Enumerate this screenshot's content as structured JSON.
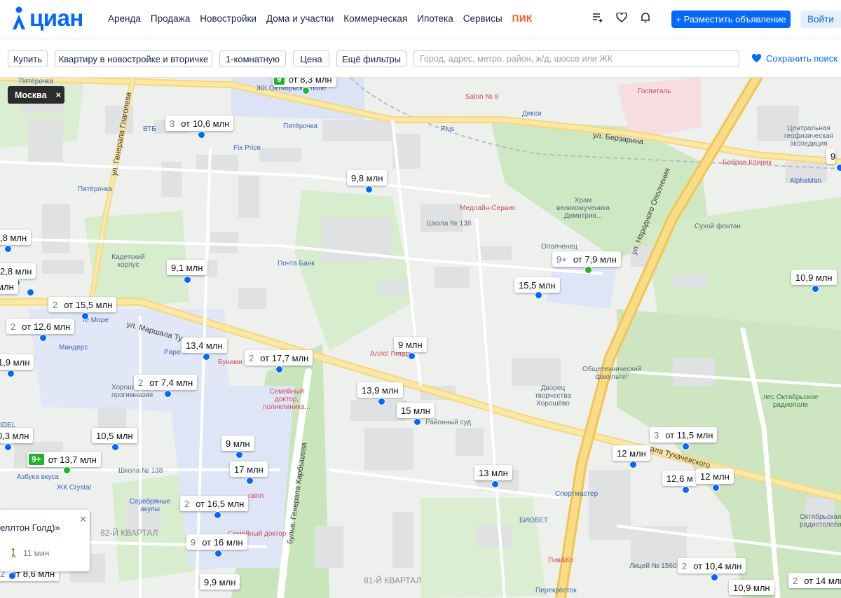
{
  "header": {
    "logo_text": "циан",
    "nav": [
      "Аренда",
      "Продажа",
      "Новостройки",
      "Дома и участки",
      "Коммерческая",
      "Ипотека",
      "Сервисы",
      "ПИК"
    ],
    "post_button": "+ Разместить объявление",
    "login_button": "Войти"
  },
  "filters": {
    "deal": "Купить",
    "type": "Квартиру в новостройке и вторичке",
    "rooms": "1-комнатную",
    "price": "Цена",
    "more": "Ещё фильтры",
    "search_placeholder": "Город, адрес, метро, район, ж/д, шоссе или ЖК",
    "save_search": "Сохранить поиск"
  },
  "map": {
    "city_chip": "Москва",
    "streets": {
      "tuhachevsky": "ул. Маршала Тухачевского",
      "tuhachevsky2": "ала Тухачевского",
      "berzarina": "ул. Берзарина",
      "narodnogo": "ул. Народного Ополчения",
      "glagoleva": "ул. Генерала Глаголева",
      "karbysheva": "бульв. Генерала Карбышева",
      "kvartal82": "82-Й КВАРТАЛ",
      "kvartal81": "81-Й КВАРТАЛ"
    },
    "pois": {
      "vtb": "ВТБ",
      "pyat1": "Пятёрочка",
      "pyat2": "Пятёрочка",
      "pyat3": "Пятёрочка",
      "fixprice": "Fix Price",
      "zhk": "ЖК Октябрьск... поле",
      "salon": "Salon № 8",
      "diksi": "Дикси",
      "plus": "Plus",
      "gospital": "Госпиталь",
      "geo": "Центральная геофизическая экспедиция",
      "bobrov": "Бобров Клиник",
      "alphaman": "AlphaMan",
      "hram": "Храм великомученика Димитрия...",
      "medline": "Медлайн-Сервис",
      "shkola138": "Школа № 138",
      "opolchenets": "Ополченец",
      "suhoy": "Сухой фонтан",
      "kadet": "Кадетский корпус",
      "pochta": "Почта Банк",
      "more": "те Море",
      "mandres": "Мандерс",
      "papa": "Papa ...",
      "bunami": "Бунами",
      "allo": "Алло! Пицца",
      "obsh": "Общетехнический факультет",
      "horosh_prog": "Хороше прогимназия",
      "semdoc": "Семейный доктор, поликлиника...",
      "dvorets": "Дворец творчества Хорошёво",
      "les": "лес Октябрьское радиополе",
      "raysud": "Районный суд",
      "azbuka": "Азбука вкуса",
      "zhkcrystal": "ЖК Crystal",
      "shkola138b": "Школа № 138",
      "serebr": "Серебряные акулы",
      "sportmaster": "Спортмастер",
      "biovet": "БИОВЕТ",
      "pivko": "Пив&Ко",
      "licey": "Лицей № 1560",
      "perekrestok": "Перекрёсток",
      "telebash": "Октябрьская радиотелебаш",
      "semdoc2": "Семейный доктор",
      "idel": "IDEL",
      "rain": "rainn"
    },
    "pins": [
      {
        "count": "9",
        "green": true,
        "price": "от 8,3 млн"
      },
      {
        "count": "3",
        "green": false,
        "price": "от 10,6 млн"
      },
      {
        "count": "",
        "green": false,
        "price": "9,8 млн"
      },
      {
        "count": "9",
        "green": false,
        "price": "9 м"
      },
      {
        "count": "",
        "green": false,
        "price": ",8 млн"
      },
      {
        "count": "",
        "green": false,
        "price": "2,8 млн"
      },
      {
        "count": "",
        "green": false,
        "price": "млн"
      },
      {
        "count": "",
        "green": false,
        "price": "9,1 млн"
      },
      {
        "count": "9+",
        "green": false,
        "price": "от 7,9 млн"
      },
      {
        "count": "",
        "green": false,
        "price": "15,5 млн"
      },
      {
        "count": "",
        "green": false,
        "price": "10,9 млн"
      },
      {
        "count": "2",
        "green": false,
        "price": "от 15,5 млн"
      },
      {
        "count": "2",
        "green": false,
        "price": "от 12,6 млн"
      },
      {
        "count": "",
        "green": false,
        "price": "13,4 млн"
      },
      {
        "count": "2",
        "green": false,
        "price": "от 17,7 млн"
      },
      {
        "count": "",
        "green": false,
        "price": "9 млн"
      },
      {
        "count": "",
        "green": false,
        "price": "1,9 млн"
      },
      {
        "count": "2",
        "green": false,
        "price": "от 7,4 млн"
      },
      {
        "count": "",
        "green": false,
        "price": "13,9 млн"
      },
      {
        "count": "",
        "green": false,
        "price": "15 млн"
      },
      {
        "count": "",
        "green": false,
        "price": "0,3 млн"
      },
      {
        "count": "",
        "green": false,
        "price": "10,5 млн"
      },
      {
        "count": "",
        "green": false,
        "price": "9 млн"
      },
      {
        "count": "3",
        "green": false,
        "price": "от 11,5 млн"
      },
      {
        "count": "",
        "green": false,
        "price": "12 млн"
      },
      {
        "count": "9+",
        "green": true,
        "price": "от 13,7 млн"
      },
      {
        "count": "",
        "green": false,
        "price": "17 млн"
      },
      {
        "count": "",
        "green": false,
        "price": "13 млн"
      },
      {
        "count": "",
        "green": false,
        "price": "12,6 м"
      },
      {
        "count": "",
        "green": false,
        "price": "12 млн"
      },
      {
        "count": "2",
        "green": false,
        "price": "от 16,5 млн"
      },
      {
        "count": "9",
        "green": false,
        "price": "от 16 млн"
      },
      {
        "count": "2",
        "green": false,
        "price": "от 10,4 млн"
      },
      {
        "count": "",
        "green": false,
        "price": "10,9 млн"
      },
      {
        "count": "2",
        "green": false,
        "price": "от 14 млн"
      },
      {
        "count": "2",
        "green": false,
        "price": "от 8,6 млн"
      },
      {
        "count": "",
        "green": false,
        "price": "9,9 млн"
      }
    ],
    "popup": {
      "title": "еллтон Голд)»",
      "walk": "11 мин"
    }
  }
}
